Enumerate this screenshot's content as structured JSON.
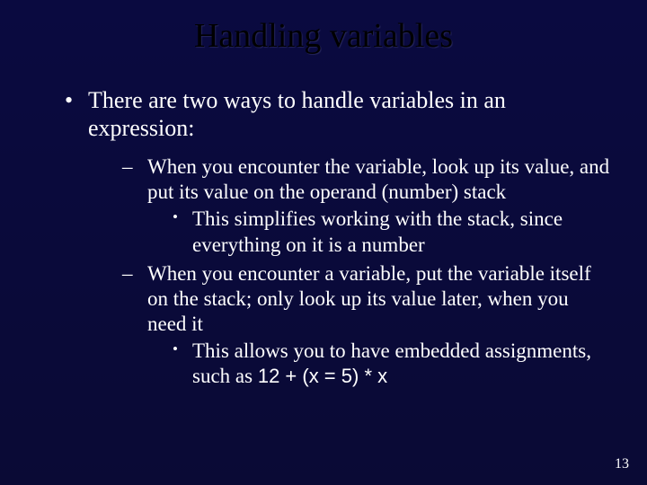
{
  "title": "Handling variables",
  "bullet1": "There are two ways to handle variables in an expression:",
  "sub1": "When you encounter the variable, look up its value, and put its value on the operand (number) stack",
  "sub1a": "This simplifies working with the stack, since everything on it is a number",
  "sub2": "When you encounter a variable, put the variable itself on the stack; only look up its value later, when you need it",
  "sub2a_prefix": "This allows you to have embedded assignments, such as ",
  "sub2a_code": "12 + (x = 5) * x",
  "page_number": "13"
}
